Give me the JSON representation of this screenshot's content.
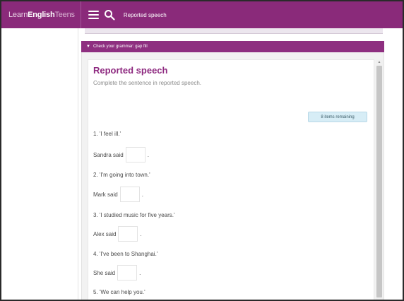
{
  "topbar": {
    "brand_learn": "Learn",
    "brand_english": "English",
    "brand_teens": "Teens",
    "title": "Reported speech",
    "menu_icon": "hamburger-menu-icon",
    "search_icon": "search-icon"
  },
  "accordion": {
    "indicator": "▼",
    "label": "Check your grammar: gap fill"
  },
  "exercise": {
    "title": "Reported speech",
    "instruction": "Complete the sentence in reported speech.",
    "remaining": "8 items remaining",
    "questions": [
      {
        "prompt": "1. 'I feel ill.'",
        "prefix": "Sandra said",
        "value": "",
        "suffix": "."
      },
      {
        "prompt": "2. 'I'm going into town.'",
        "prefix": "Mark said",
        "value": "",
        "suffix": "."
      },
      {
        "prompt": "3. 'I studied music for five years.'",
        "prefix": "Alex said",
        "value": "",
        "suffix": "."
      },
      {
        "prompt": "4. 'I've been to Shanghai.'",
        "prefix": "She said",
        "value": "",
        "suffix": "."
      },
      {
        "prompt": "5. 'We can help you.'"
      }
    ]
  },
  "colors": {
    "brand": "#8a2a7a",
    "accent": "#8e2a80",
    "badge_bg": "#d7edf6"
  }
}
